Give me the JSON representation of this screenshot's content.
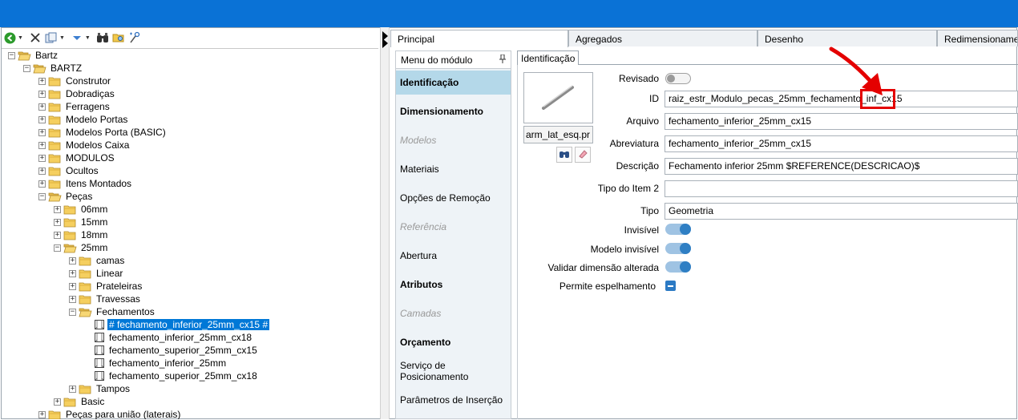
{
  "tabs": [
    {
      "label": "Principal",
      "active": true
    },
    {
      "label": "Agregados",
      "active": false
    },
    {
      "label": "Desenho",
      "active": false
    },
    {
      "label": "Redimensionamento",
      "active": false
    }
  ],
  "tree": {
    "nodes": [
      {
        "label": "Bartz",
        "level": 0,
        "exp": "−",
        "kind": "folder",
        "open": true
      },
      {
        "label": "BARTZ",
        "level": 1,
        "exp": "−",
        "kind": "folder",
        "open": true
      },
      {
        "label": "Construtor",
        "level": 2,
        "exp": "+",
        "kind": "folder"
      },
      {
        "label": "Dobradiças",
        "level": 2,
        "exp": "+",
        "kind": "folder"
      },
      {
        "label": "Ferragens",
        "level": 2,
        "exp": "+",
        "kind": "folder"
      },
      {
        "label": "Modelo Portas",
        "level": 2,
        "exp": "+",
        "kind": "folder"
      },
      {
        "label": "Modelos Porta (BASIC)",
        "level": 2,
        "exp": "+",
        "kind": "folder"
      },
      {
        "label": "Modelos Caixa",
        "level": 2,
        "exp": "+",
        "kind": "folder"
      },
      {
        "label": "MODULOS",
        "level": 2,
        "exp": "+",
        "kind": "folder"
      },
      {
        "label": "Ocultos",
        "level": 2,
        "exp": "+",
        "kind": "folder"
      },
      {
        "label": "Itens Montados",
        "level": 2,
        "exp": "+",
        "kind": "folder"
      },
      {
        "label": "Peças",
        "level": 2,
        "exp": "−",
        "kind": "folder",
        "open": true
      },
      {
        "label": "06mm",
        "level": 3,
        "exp": "+",
        "kind": "folder"
      },
      {
        "label": "15mm",
        "level": 3,
        "exp": "+",
        "kind": "folder"
      },
      {
        "label": "18mm",
        "level": 3,
        "exp": "+",
        "kind": "folder"
      },
      {
        "label": "25mm",
        "level": 3,
        "exp": "−",
        "kind": "folder",
        "open": true
      },
      {
        "label": "camas",
        "level": 4,
        "exp": "+",
        "kind": "folder"
      },
      {
        "label": "Linear",
        "level": 4,
        "exp": "+",
        "kind": "folder"
      },
      {
        "label": "Prateleiras",
        "level": 4,
        "exp": "+",
        "kind": "folder"
      },
      {
        "label": "Travessas",
        "level": 4,
        "exp": "+",
        "kind": "folder"
      },
      {
        "label": "Fechamentos",
        "level": 4,
        "exp": "−",
        "kind": "folder",
        "open": true
      },
      {
        "label": "# fechamento_inferior_25mm_cx15 #",
        "level": 5,
        "exp": "",
        "kind": "doc",
        "selected": true
      },
      {
        "label": "fechamento_inferior_25mm_cx18",
        "level": 5,
        "exp": "",
        "kind": "doc"
      },
      {
        "label": "fechamento_superior_25mm_cx15",
        "level": 5,
        "exp": "",
        "kind": "doc"
      },
      {
        "label": "fechamento_inferior_25mm",
        "level": 5,
        "exp": "",
        "kind": "doc"
      },
      {
        "label": "fechamento_superior_25mm_cx18",
        "level": 5,
        "exp": "",
        "kind": "doc"
      },
      {
        "label": "Tampos",
        "level": 4,
        "exp": "+",
        "kind": "folder"
      },
      {
        "label": "Basic",
        "level": 3,
        "exp": "+",
        "kind": "folder"
      },
      {
        "label": "Peças para união (laterais)",
        "level": 2,
        "exp": "+",
        "kind": "folder"
      }
    ]
  },
  "menu": {
    "header": "Menu do módulo",
    "items": [
      {
        "label": "Identificação",
        "state": "active"
      },
      {
        "label": "Dimensionamento",
        "state": "bold"
      },
      {
        "label": "Modelos",
        "state": "disabled"
      },
      {
        "label": "Materiais",
        "state": "normal"
      },
      {
        "label": "Opções de Remoção",
        "state": "normal"
      },
      {
        "label": "Referência",
        "state": "disabled"
      },
      {
        "label": "Abertura",
        "state": "normal"
      },
      {
        "label": "Atributos",
        "state": "bold"
      },
      {
        "label": "Camadas",
        "state": "disabled"
      },
      {
        "label": "Orçamento",
        "state": "bold"
      },
      {
        "label": "Serviço de Posicionamento",
        "state": "normal"
      },
      {
        "label": "Parâmetros de Inserção",
        "state": "normal"
      }
    ]
  },
  "content": {
    "tab_label": "Identificação",
    "thumb_label": "arm_lat_esq.pr",
    "fields": {
      "revisado": {
        "label": "Revisado",
        "on": false
      },
      "id": {
        "label": "ID",
        "value": "raiz_estr_Modulo_pecas_25mm_fechamento_inf_cx15"
      },
      "arquivo": {
        "label": "Arquivo",
        "value": "fechamento_inferior_25mm_cx15"
      },
      "abreviatura": {
        "label": "Abreviatura",
        "value": "fechamento_inferior_25mm_cx15"
      },
      "descricao": {
        "label": "Descrição",
        "value": "Fechamento inferior 25mm $REFERENCE(DESCRICAO)$"
      },
      "tipo_item2": {
        "label": "Tipo do Item 2",
        "value": ""
      },
      "tipo": {
        "label": "Tipo",
        "value": "Geometria"
      },
      "invisivel": {
        "label": "Invisível",
        "on": true
      },
      "modelo_invisivel": {
        "label": "Modelo invisível",
        "on": true
      },
      "validar": {
        "label": "Validar dimensão alterada",
        "on": true
      },
      "espelhamento": {
        "label": "Permite espelhamento",
        "checked": "indeterminate"
      }
    }
  },
  "colors": {
    "titlebar": "#0a72d6",
    "selection": "#0078d7",
    "menu_active": "#b4d8e9",
    "toggle_on": "#2f7fc4",
    "annotation": "#e40000"
  },
  "icons": [
    "back-icon",
    "close-icon",
    "copy-icon",
    "move-down-icon",
    "binoculars-icon",
    "folder-search-icon",
    "settings-icon",
    "pin-icon",
    "eraser-icon"
  ]
}
